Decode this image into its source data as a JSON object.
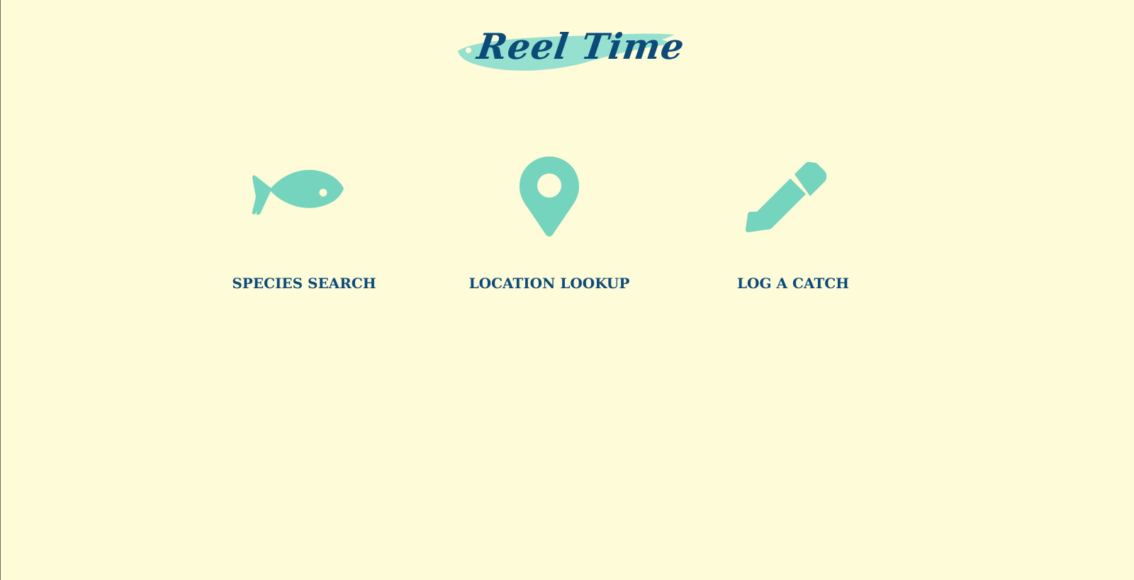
{
  "brand": {
    "title": "Reel Time",
    "icon": "fish-brush-logo"
  },
  "colors": {
    "background": "#fefbd8",
    "accent": "#74d4bd",
    "text": "#0c4a78"
  },
  "nav": [
    {
      "label": "SPECIES SEARCH",
      "icon": "fish-icon"
    },
    {
      "label": "LOCATION LOOKUP",
      "icon": "map-pin-icon"
    },
    {
      "label": "LOG A CATCH",
      "icon": "pencil-icon"
    }
  ]
}
